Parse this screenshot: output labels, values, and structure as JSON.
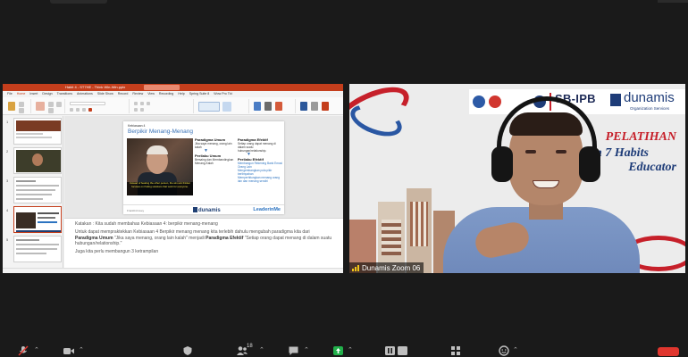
{
  "ppt": {
    "filename": "Habit 4 - ST7HE - Think Win-Win.pptx",
    "menu": [
      "File",
      "Home",
      "Insert",
      "Design",
      "Transitions",
      "Animations",
      "Slide Show",
      "Record",
      "Review",
      "View",
      "Recording",
      "Help",
      "Spring Suite 8",
      "Wow Pro Tkt"
    ],
    "active_menu": "Home",
    "thumb_numbers": [
      "1",
      "2",
      "3",
      "4",
      "5"
    ],
    "slide": {
      "habit": "Kebiasaan 4",
      "title": "Berpikir Menang-Menang",
      "caption": [
        "Instead of beating the other person, the win-win thinker focuses on finding solutions that work for everyone."
      ],
      "col1": {
        "head1": "Paradigma Umum",
        "text1": "Jika saya menang, orang lain kalah",
        "head2": "Perilaku Umum",
        "items": [
          "Bersaing dan Membandingkan",
          "Menang-Kalah"
        ]
      },
      "col2": {
        "head1": "Paradigma Efektif",
        "text1": "Setiap orang dapat menang di dalam suatu hubungan/relationship.",
        "head2": "Perilaku Efektif",
        "items": [
          "Membangun Rekening Bank Emosi Orang Lain",
          "Mengembangkan pola pikir berlimpahan",
          "Memperhitungkan menang orang lain dan menang sendiri"
        ]
      },
      "footer_left": "FranklinCovey",
      "footer_logo": "dunamis",
      "footer_right": "LeaderinMe"
    },
    "notes": {
      "p1": "Katakan : Kita sudah membahas Kebiasaan 4: berpikir menang-menang",
      "p2_a": "Untuk dapat mempraktekkan Kebiasaan 4 Berpikir menang menang kita terlebih dahulu mengubah paradigma kita dari ",
      "p2_b": "Paradigma Umum",
      "p2_c": " \"Jika saya menang, orang lain kalah\" menjadi ",
      "p2_d": "Paradigma Efektif",
      "p2_e": " \"Setiap orang dapat menang di dalam suatu hubungan/relationship.\"",
      "p3": "Juga kita perlu membangun 3 ketrampilan"
    }
  },
  "cam": {
    "logo_sb": "SB-IPB",
    "logo_dunamis": "dunamis",
    "logo_dunamis_sub": "Organization Services",
    "pelatihan": "PELATIHAN",
    "program": "rogram 7 Habits",
    "educator": "Educator",
    "participant": "Dunamis Zoom 06"
  },
  "toolbar": {
    "participants_count": "18",
    "icons": [
      "mic-muted-icon",
      "video-icon",
      "security-icon",
      "participants-icon",
      "chat-icon",
      "share-screen-icon",
      "pause-share-icon",
      "apps-icon",
      "reactions-icon",
      "leave-icon"
    ]
  },
  "colors": {
    "ppt_accent": "#c43e1c",
    "slide_title": "#3a73b8",
    "brand_red": "#c6202a",
    "brand_navy": "#1e3c78",
    "share_green": "#22b04b",
    "leave_red": "#e0362e"
  }
}
